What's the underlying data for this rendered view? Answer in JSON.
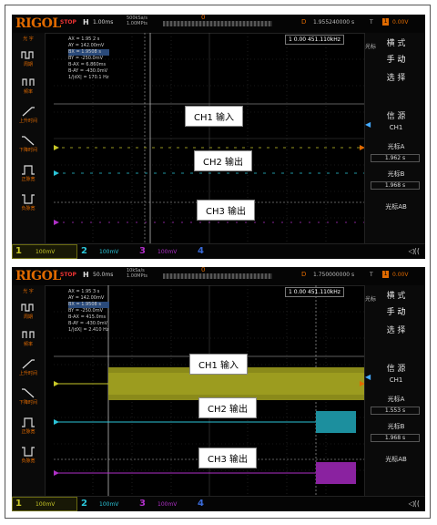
{
  "scope_top": {
    "logo": "RIGOL",
    "status": "STOP",
    "h_label": "H",
    "timebase": "1.00ms",
    "sample_lines": [
      "500kSa/s",
      "1.00MPts"
    ],
    "trig_pos_marker": "0",
    "delay_label": "D",
    "delay_value": "1.955240000 s",
    "trig_label": "T",
    "trig_badge": "1",
    "trig_level": "0.00V",
    "meas": [
      {
        "k": "AX",
        "v": "= 1.95 2 s"
      },
      {
        "k": "AY",
        "v": "= 142.00mV"
      },
      {
        "k": "BX",
        "v": "= 1.9508 s"
      },
      {
        "k": "BY",
        "v": "= -250.0mV"
      },
      {
        "k": "B-AX",
        "v": "= 6.860ms"
      },
      {
        "k": "B-AY",
        "v": "= -430.0mV"
      },
      {
        "k": "1/|dX|",
        "v": "= 170.1 Hz"
      }
    ],
    "cursor_readout": "1 0.00 451.110kHz",
    "ch_labels": [
      "CH1 输入",
      "CH2 输出",
      "CH3 输出"
    ],
    "left_menu": [
      "光 字",
      "周期",
      "频率",
      "上升时间",
      "下降时间",
      "正脉宽",
      "负脉宽"
    ],
    "right_menu": {
      "mode_label": "横 式",
      "mode_value": "手 动",
      "select_label": "选 择",
      "source_label": "信 源",
      "source_value": "CH1",
      "cursorA_label": "光标A",
      "cursorA_value": "1.962 s",
      "cursorB_label": "光标B",
      "cursorB_value": "1.968 s",
      "cursorAB_label": "光标AB",
      "side_label": "光标"
    },
    "bottom": {
      "ch1": "1",
      "ch1_scale": "100mV",
      "ch2": "2",
      "ch2_scale": "100mV",
      "ch3": "3",
      "ch3_scale": "100mV",
      "ch4": "4",
      "ch4_scale": "",
      "sound": "◁(("
    }
  },
  "scope_bottom": {
    "logo": "RIGOL",
    "status": "STOP",
    "h_label": "H",
    "timebase": "50.0ms",
    "sample_lines": [
      "10kSa/s",
      "1.00MPts"
    ],
    "trig_pos_marker": "0",
    "delay_label": "D",
    "delay_value": "1.750000000 s",
    "trig_label": "T",
    "trig_badge": "1",
    "trig_level": "0.00V",
    "meas": [
      {
        "k": "AX",
        "v": "= 1.95 3 s"
      },
      {
        "k": "AY",
        "v": "= 142.00mV"
      },
      {
        "k": "BX",
        "v": "= 1.9508 s"
      },
      {
        "k": "BY",
        "v": "= -250.0mV"
      },
      {
        "k": "B-AX",
        "v": "= 415.0ms"
      },
      {
        "k": "B-AY",
        "v": "= -430.0mV"
      },
      {
        "k": "1/|dX|",
        "v": "= 2.410 Hz"
      }
    ],
    "cursor_readout": "1 0.00 451.110kHz",
    "ch_labels": [
      "CH1 输入",
      "CH2 输出",
      "CH3 输出"
    ],
    "left_menu": [
      "光 字",
      "周期",
      "频率",
      "上升时间",
      "下降时间",
      "正脉宽",
      "负脉宽"
    ],
    "right_menu": {
      "mode_label": "横 式",
      "mode_value": "手 动",
      "select_label": "选 择",
      "source_label": "信 源",
      "source_value": "CH1",
      "cursorA_label": "光标A",
      "cursorA_value": "1.553 s",
      "cursorB_label": "光标B",
      "cursorB_value": "1.968 s",
      "cursorAB_label": "光标AB",
      "side_label": "光标"
    },
    "bottom": {
      "ch1": "1",
      "ch1_scale": "100mV",
      "ch2": "2",
      "ch2_scale": "100mV",
      "ch3": "3",
      "ch3_scale": "100mV",
      "ch4": "4",
      "ch4_scale": "",
      "sound": "◁(("
    }
  },
  "colors": {
    "ch1": "#c8c828",
    "ch2": "#2bc4d8",
    "ch3": "#b030c8",
    "ch4": "#3a6ad8",
    "accent": "#e06a00"
  }
}
